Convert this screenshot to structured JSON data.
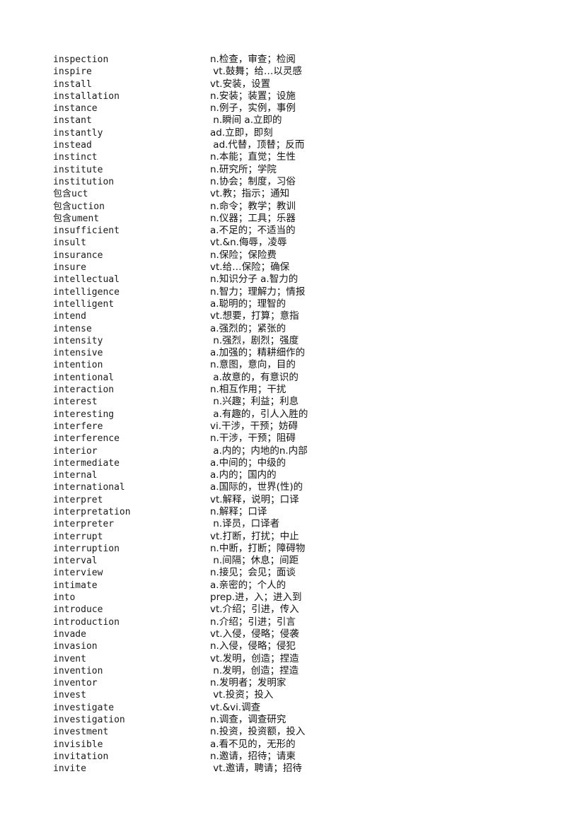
{
  "page": {
    "background_color": "#ffffff",
    "text_color": "#000000",
    "kind": "vocabulary-glossary-list"
  },
  "glossary": {
    "entries": [
      {
        "term": "inspection",
        "definition": "n.检查，审查；检阅"
      },
      {
        "term": "inspire",
        "definition": " vt.鼓舞；给…以灵感"
      },
      {
        "term": "install",
        "definition": "vt.安装，设置"
      },
      {
        "term": "installation",
        "definition": "n.安装；装置；设施"
      },
      {
        "term": "instance",
        "definition": "n.例子，实例，事例"
      },
      {
        "term": "instant",
        "definition": " n.瞬间 a.立即的"
      },
      {
        "term": "instantly",
        "definition": "ad.立即，即刻"
      },
      {
        "term": "instead",
        "definition": " ad.代替，顶替；反而"
      },
      {
        "term": "instinct",
        "definition": "n.本能；直觉；生性"
      },
      {
        "term": "institute",
        "definition": "n.研究所；学院"
      },
      {
        "term": "institution",
        "definition": "n.协会；制度，习俗"
      },
      {
        "term": "包含uct",
        "definition": "vt.教；指示；通知"
      },
      {
        "term": "包含uction",
        "definition": "n.命令；教学；教训"
      },
      {
        "term": "包含ument",
        "definition": "n.仪器；工具；乐器"
      },
      {
        "term": "insufficient",
        "definition": "a.不足的；不适当的"
      },
      {
        "term": "insult",
        "definition": "vt.&n.侮辱，凌辱"
      },
      {
        "term": "insurance",
        "definition": "n.保险；保险费"
      },
      {
        "term": "insure",
        "definition": "vt.给…保险；确保"
      },
      {
        "term": "intellectual",
        "definition": "n.知识分子 a.智力的"
      },
      {
        "term": "intelligence",
        "definition": "n.智力；理解力；情报"
      },
      {
        "term": "intelligent",
        "definition": "a.聪明的；理智的"
      },
      {
        "term": "intend",
        "definition": "vt.想要，打算；意指"
      },
      {
        "term": "intense",
        "definition": "a.强烈的；紧张的"
      },
      {
        "term": "intensity",
        "definition": " n.强烈，剧烈；强度"
      },
      {
        "term": "intensive",
        "definition": "a.加强的；精耕细作的"
      },
      {
        "term": "intention",
        "definition": "n.意图，意向，目的"
      },
      {
        "term": "intentional",
        "definition": " a.故意的，有意识的"
      },
      {
        "term": "interaction",
        "definition": "n.相互作用；干扰"
      },
      {
        "term": "interest",
        "definition": " n.兴趣；利益；利息"
      },
      {
        "term": "interesting",
        "definition": " a.有趣的，引人入胜的"
      },
      {
        "term": "interfere",
        "definition": "vi.干涉，干预；妨碍"
      },
      {
        "term": "interference",
        "definition": "n.干涉，干预；阻碍"
      },
      {
        "term": "interior",
        "definition": " a.内的；内地的n.内部"
      },
      {
        "term": "intermediate",
        "definition": "a.中间的；中级的"
      },
      {
        "term": "internal",
        "definition": "a.内的；国内的"
      },
      {
        "term": "international",
        "definition": "a.国际的，世界(性)的"
      },
      {
        "term": "interpret",
        "definition": "vt.解释，说明；口译"
      },
      {
        "term": "interpretation",
        "definition": "n.解释；口译"
      },
      {
        "term": "interpreter",
        "definition": " n.译员，口译者"
      },
      {
        "term": "interrupt",
        "definition": "vt.打断，打扰；中止"
      },
      {
        "term": "interruption",
        "definition": "n.中断，打断；障碍物"
      },
      {
        "term": "interval",
        "definition": " n.间隔；休息；间距"
      },
      {
        "term": "interview",
        "definition": "n.接见；会见；面谈"
      },
      {
        "term": "intimate",
        "definition": "a.亲密的；个人的"
      },
      {
        "term": "into",
        "definition": "prep.进，入；进入到"
      },
      {
        "term": "introduce",
        "definition": "vt.介绍；引进，传入"
      },
      {
        "term": "introduction",
        "definition": "n.介绍；引进；引言"
      },
      {
        "term": "invade",
        "definition": "vt.入侵，侵略；侵袭"
      },
      {
        "term": "invasion",
        "definition": "n.入侵，侵略；侵犯"
      },
      {
        "term": "invent",
        "definition": "vt.发明，创造；捏造"
      },
      {
        "term": "invention",
        "definition": " n.发明，创造；捏造"
      },
      {
        "term": "inventor",
        "definition": "n.发明者；发明家"
      },
      {
        "term": "invest",
        "definition": " vt.投资；投入"
      },
      {
        "term": "investigate",
        "definition": "vt.&vi.调查"
      },
      {
        "term": "investigation",
        "definition": "n.调查，调查研究"
      },
      {
        "term": "investment",
        "definition": "n.投资，投资额，投入"
      },
      {
        "term": "invisible",
        "definition": "a.看不见的，无形的"
      },
      {
        "term": "invitation",
        "definition": "n.邀请，招待；请柬"
      },
      {
        "term": "invite",
        "definition": " vt.邀请，聘请；招待"
      }
    ]
  }
}
